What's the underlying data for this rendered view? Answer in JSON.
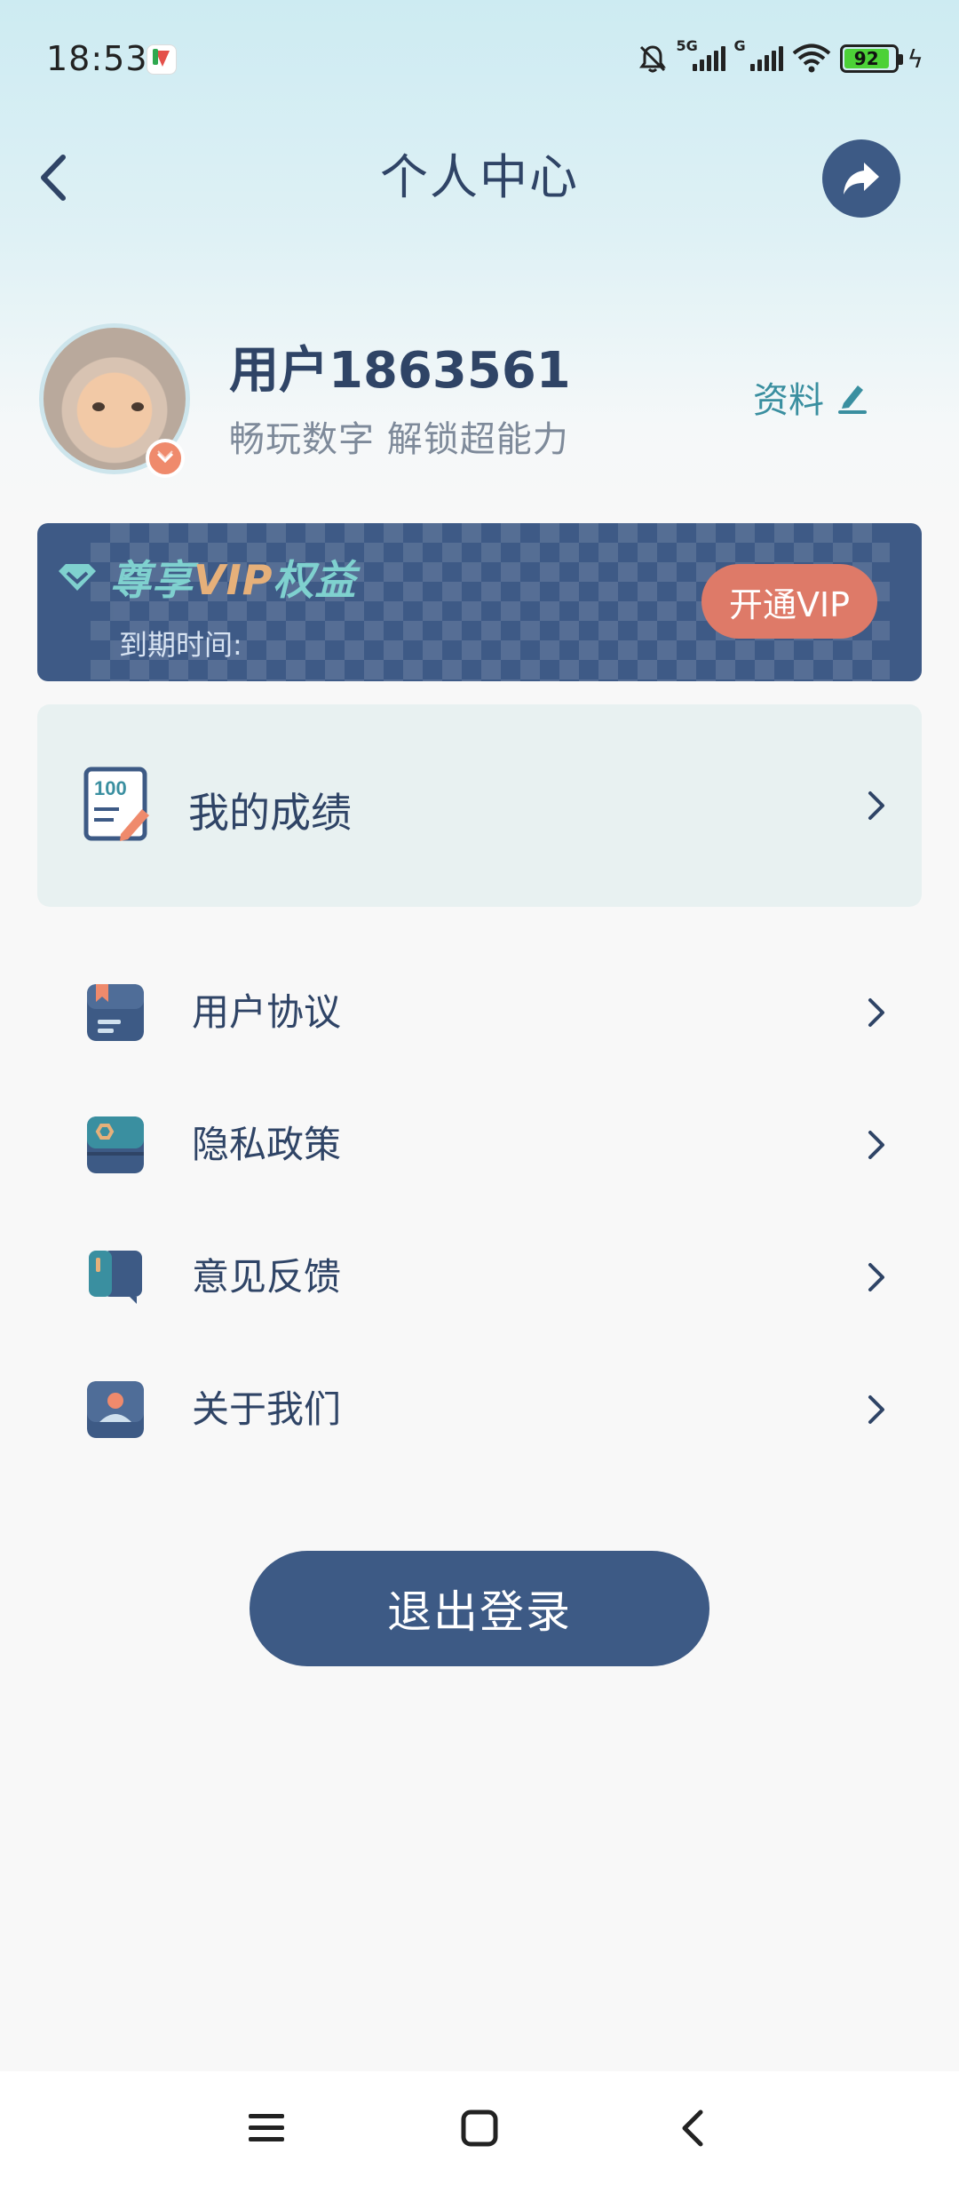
{
  "status_bar": {
    "time": "18:53",
    "network_1": "5G",
    "network_2": "G",
    "battery": "92"
  },
  "header": {
    "title": "个人中心"
  },
  "profile": {
    "username": "用户1863561",
    "slogan": "畅玩数字 解锁超能力",
    "edit_label": "资料"
  },
  "vip": {
    "title_prefix": "尊享",
    "title_vip": "VIP",
    "title_suffix": "权益",
    "expire_label": "到期时间:",
    "button_label": "开通VIP"
  },
  "score": {
    "label": "我的成绩"
  },
  "menu": {
    "items": [
      {
        "label": "用户协议"
      },
      {
        "label": "隐私政策"
      },
      {
        "label": "意见反馈"
      },
      {
        "label": "关于我们"
      }
    ]
  },
  "logout": {
    "label": "退出登录"
  },
  "colors": {
    "primary": "#3d5a85",
    "accent_teal": "#3a8fa0",
    "vip_button": "#de7a68",
    "text": "#2f4466"
  }
}
